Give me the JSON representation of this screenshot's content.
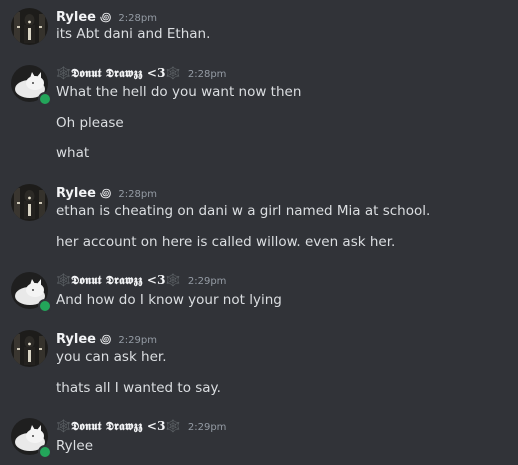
{
  "colors": {
    "background": "#313338",
    "username": "#f2f3f5",
    "message": "#dbdee1",
    "timestamp": "#949ba4",
    "online": "#23a55a"
  },
  "users": {
    "rylee": {
      "name": "Rylee",
      "badge": "꩜",
      "avatar_icon": "dark-figure-avatar-icon"
    },
    "donut": {
      "name": "🕸️𝕯𝖔𝖓𝖚𝖙 𝕯𝖗𝖆𝖜𝖟𝖟 <3🕸️",
      "avatar_icon": "white-cat-avatar-icon",
      "online": true
    }
  },
  "messages": [
    {
      "author": "Rylee",
      "badge": "꩜",
      "time": "2:28pm",
      "lines": [
        "its Abt dani and Ethan."
      ]
    },
    {
      "author": "🕸️𝕯𝖔𝖓𝖚𝖙 𝕯𝖗𝖆𝖜𝖟𝖟 <3🕸️",
      "time": "2:28pm",
      "lines": [
        "What the hell do you want now then",
        "Oh please",
        "what"
      ]
    },
    {
      "author": "Rylee",
      "badge": "꩜",
      "time": "2:28pm",
      "lines": [
        "ethan is cheating on dani w a girl named Mia at school.",
        "her account on here is called willow. even ask her."
      ]
    },
    {
      "author": "🕸️𝕯𝖔𝖓𝖚𝖙 𝕯𝖗𝖆𝖜𝖟𝖟 <3🕸️",
      "time": "2:29pm",
      "lines": [
        "And how do I know your not lying"
      ]
    },
    {
      "author": "Rylee",
      "badge": "꩜",
      "time": "2:29pm",
      "lines": [
        "you can ask her.",
        "thats all I wanted to say."
      ]
    },
    {
      "author": "🕸️𝕯𝖔𝖓𝖚𝖙 𝕯𝖗𝖆𝖜𝖟𝖟 <3🕸️",
      "time": "2:29pm",
      "lines": [
        "Rylee"
      ]
    }
  ]
}
